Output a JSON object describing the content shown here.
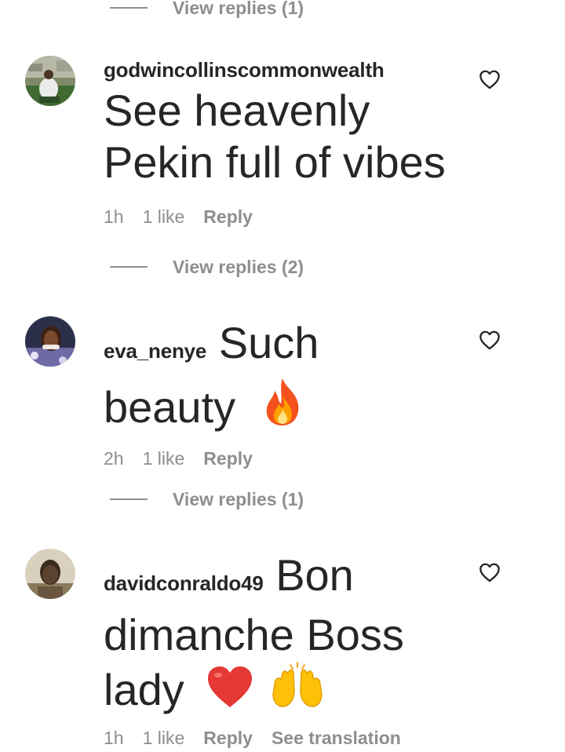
{
  "threads": [
    {
      "view_replies": "View replies (1)"
    },
    {
      "username": "godwincollinscommonwealth",
      "text_lines": [
        "See heavenly",
        "Pekin full of vibes"
      ],
      "time": "1h",
      "likes": "1 like",
      "reply_label": "Reply",
      "view_replies": "View replies (2)"
    },
    {
      "username": "eva_nenye",
      "text_first": "Such",
      "text_second": "beauty",
      "emoji": [
        "fire"
      ],
      "time": "2h",
      "likes": "1 like",
      "reply_label": "Reply",
      "view_replies": "View replies (1)"
    },
    {
      "username": "davidconraldo49",
      "text_first": "Bon",
      "text_second": "dimanche Boss",
      "text_third": "lady",
      "emoji": [
        "red-heart",
        "raising-hands"
      ],
      "time": "1h",
      "likes": "1 like",
      "reply_label": "Reply",
      "see_translation": "See translation"
    }
  ],
  "icons": {
    "like": "heart-outline-icon"
  },
  "colors": {
    "text_primary": "#262626",
    "text_secondary": "#8e8e8e",
    "background": "#ffffff"
  }
}
